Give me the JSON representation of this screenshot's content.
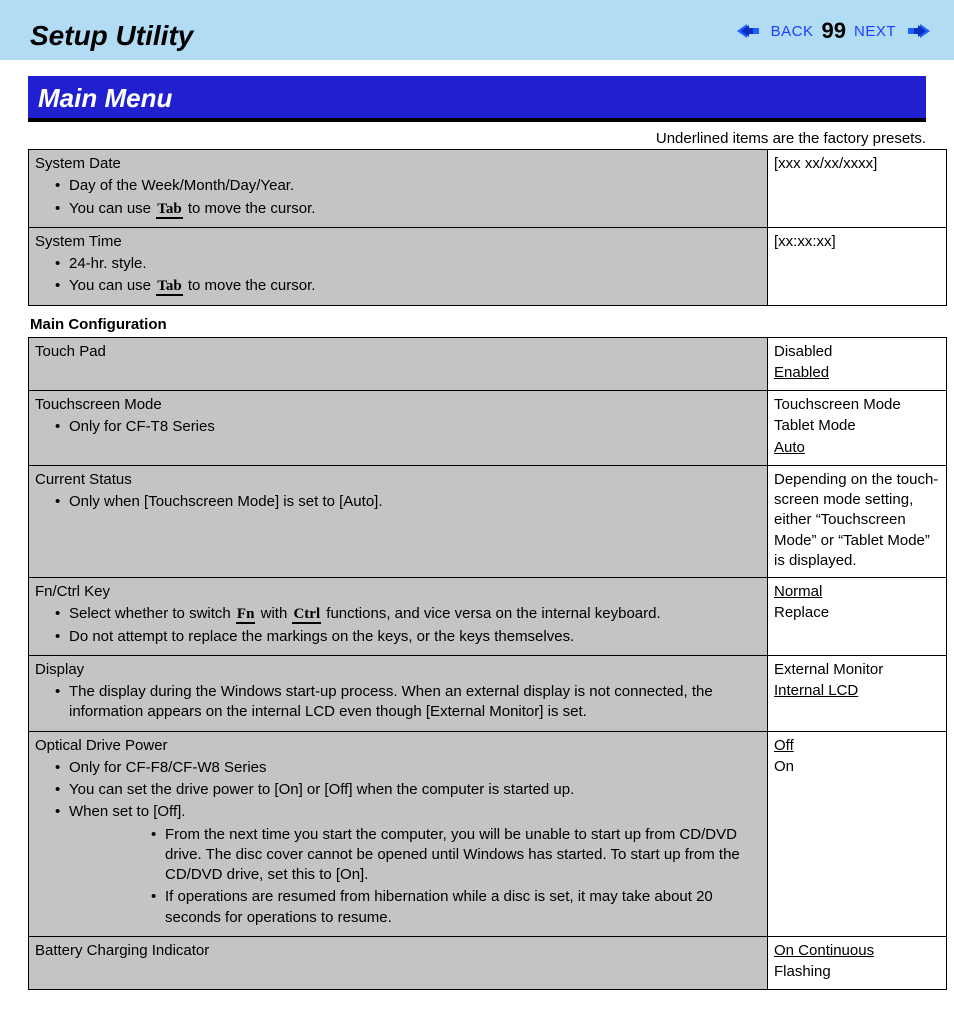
{
  "header": {
    "title": "Setup Utility",
    "back_label": "BACK",
    "next_label": "NEXT",
    "page_number": "99"
  },
  "section": {
    "title": "Main Menu",
    "preset_note": "Underlined items are the factory presets."
  },
  "rows_top": [
    {
      "title": "System Date",
      "bullets_a": "Day of the Week/Month/Day/Year.",
      "bullets_b_pre": "You can use ",
      "bullets_b_key": "Tab",
      "bullets_b_post": " to move the cursor.",
      "value": "[xxx xx/xx/xxxx]"
    },
    {
      "title": "System Time",
      "bullets_a": "24-hr. style.",
      "bullets_b_pre": "You can use ",
      "bullets_b_key": "Tab",
      "bullets_b_post": " to move the cursor.",
      "value": "[xx:xx:xx]"
    }
  ],
  "main_cfg_label": "Main Configuration",
  "rows_main": {
    "touchpad": {
      "title": "Touch Pad",
      "opt1": "Disabled",
      "opt2": "Enabled"
    },
    "tsmode": {
      "title": "Touchscreen Mode",
      "bullet": "Only for CF-T8 Series",
      "opt1": "Touchscreen Mode",
      "opt2": "Tablet Mode",
      "opt3": "Auto"
    },
    "cstatus": {
      "title": "Current Status",
      "bullet": "Only when [Touchscreen Mode] is set to [Auto].",
      "right": "Depending on the touch­screen mode setting, either “Touchscreen Mode” or “Tablet Mode” is displayed."
    },
    "fnctrl": {
      "title": "Fn/Ctrl Key",
      "b1_pre": "Select whether to switch ",
      "b1_k1": "Fn",
      "b1_mid": " with ",
      "b1_k2": "Ctrl",
      "b1_post": " functions, and vice versa on the internal keyboard.",
      "b2": "Do not attempt to replace the markings on the keys, or the keys themselves.",
      "opt1": "Normal",
      "opt2": "Replace"
    },
    "display": {
      "title": "Display",
      "bullet": "The display during the Windows start-up process. When an external display is not connected, the information appears on the internal LCD even though [External Monitor] is set.",
      "opt1": "External Monitor",
      "opt2": "Internal LCD"
    },
    "odp": {
      "title": "Optical Drive Power",
      "b1": "Only for CF-F8/CF-W8 Series",
      "b2": "You can set the drive power to [On] or [Off] when the computer is started up.",
      "b3": "When set to [Off].",
      "s1": "From the next time you start the computer, you will be unable to start up from CD/DVD drive. The disc cover cannot be opened until Windows has started. To start up from the CD/DVD drive, set this to [On].",
      "s2": "If operations are resumed from hibernation while a disc is set, it may take about 20 seconds for operations to resume.",
      "opt1": "Off",
      "opt2": "On"
    },
    "bci": {
      "title": "Battery Charging Indicator",
      "opt1": "On Continuous",
      "opt2": "Flashing"
    }
  }
}
